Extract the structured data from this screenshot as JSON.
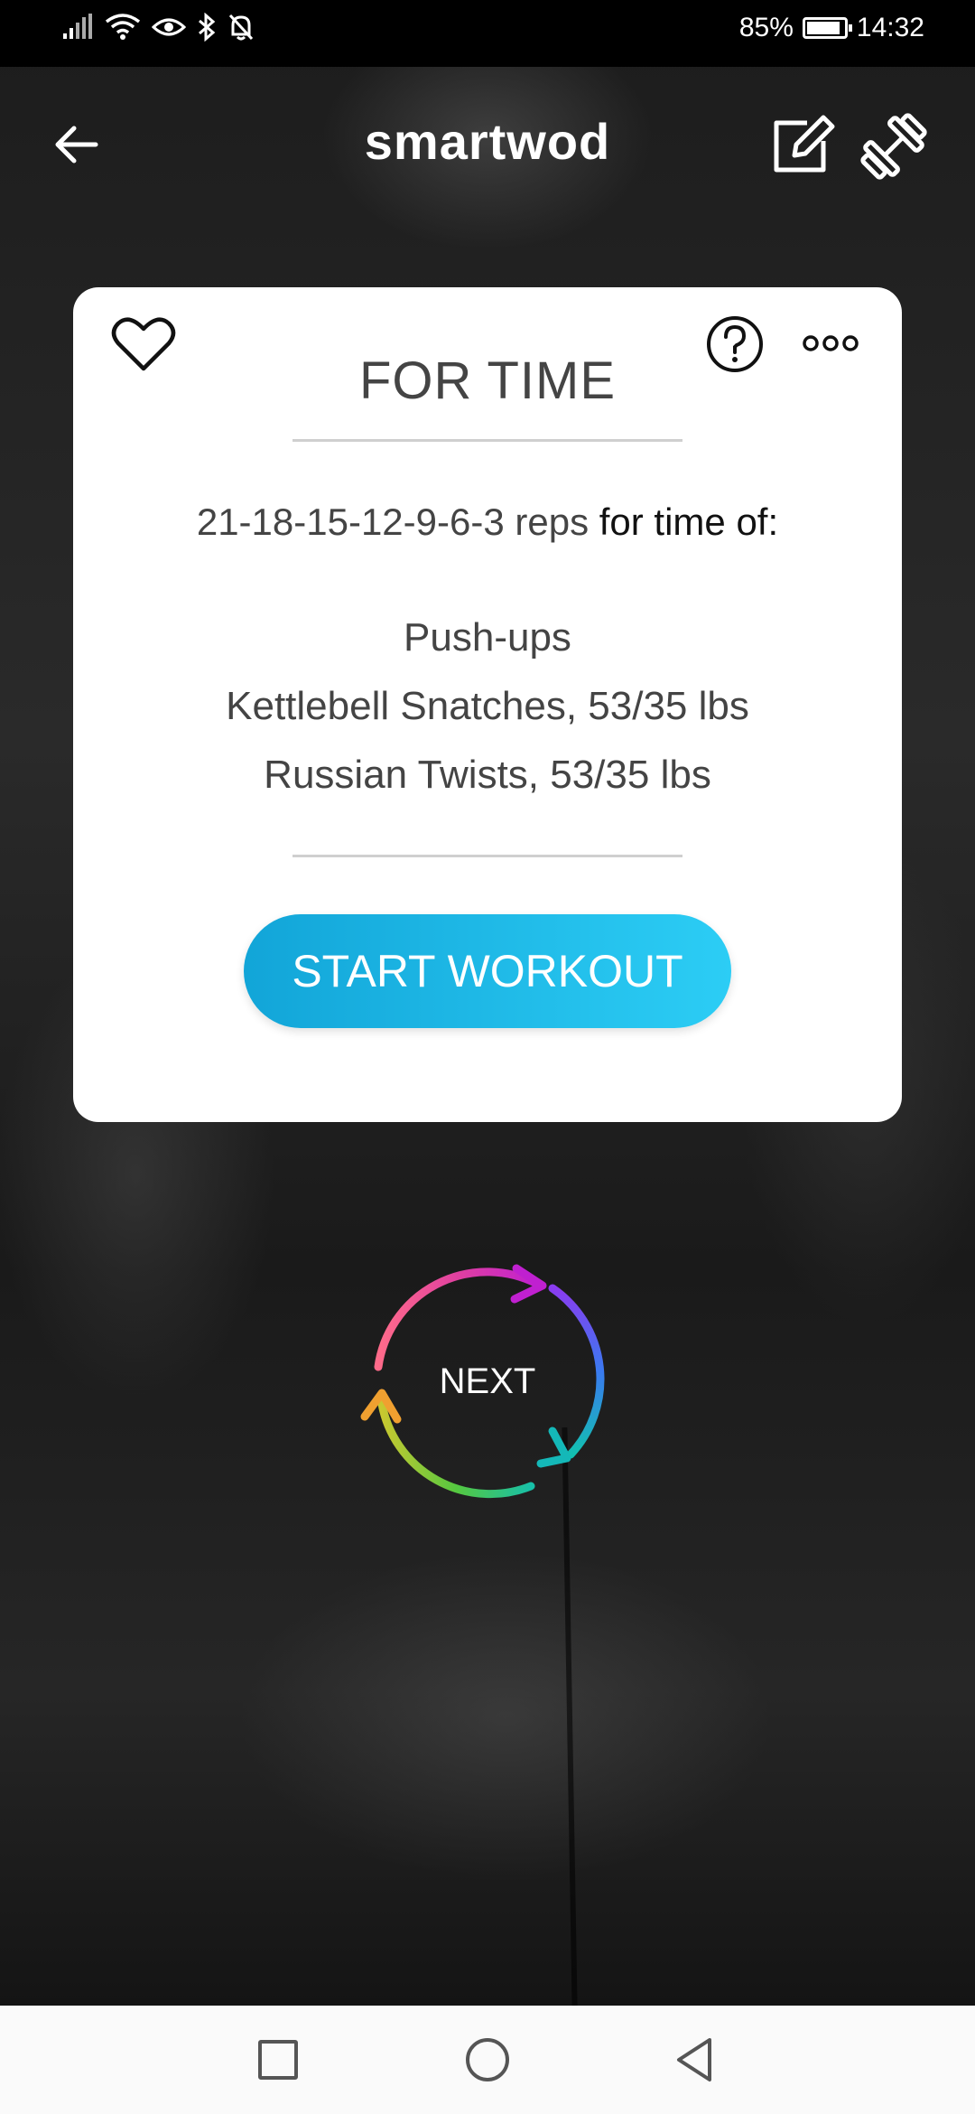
{
  "status_bar": {
    "battery": "85%",
    "time": "14:32"
  },
  "header": {
    "title": "smartwod"
  },
  "card": {
    "type": "FOR TIME",
    "reps": "21-18-15-12-9-6-3 reps",
    "scheme_suffix": "for time of:",
    "movements": [
      "Push-ups",
      "Kettlebell Snatches, 53/35 lbs",
      "Russian Twists, 53/35 lbs"
    ],
    "start_label": "START WORKOUT"
  },
  "next": {
    "label": "NEXT"
  },
  "colors": {
    "accent_start": "#12a5d8",
    "accent_end": "#2ccdf5"
  },
  "icons": {
    "back": "arrow-left-icon",
    "edit": "edit-icon",
    "equipment": "dumbbell-icon",
    "favorite": "heart-icon",
    "help": "question-icon",
    "more": "more-icon",
    "next": "cycle-arrows-icon"
  }
}
